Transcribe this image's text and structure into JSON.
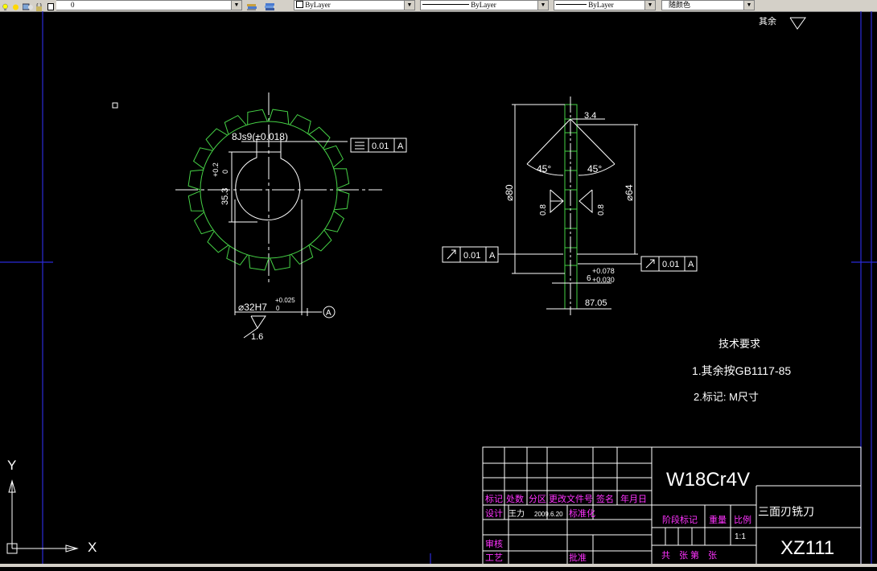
{
  "toolbar": {
    "layer_value": "0",
    "color_value": "ByLayer",
    "linetype_value": "ByLayer",
    "lineweight_value": "ByLayer",
    "plotstyle_value": "随颜色"
  },
  "drawing": {
    "surface_roughness_other": "其余",
    "left_view": {
      "keyway_dim": "8Js9(±0.018)",
      "flatness_value": "0.01",
      "datum_ref_1": "A",
      "key_height_dim": "35.3",
      "key_height_tol": "+0.2",
      "key_height_tol_low": "0",
      "bore_dim": "⌀32H7",
      "bore_tol_up": "+0.025",
      "bore_tol_low": "0",
      "datum_label": "A",
      "roughness_value": "1.6"
    },
    "right_view": {
      "width_dim": "3.4",
      "angle_left": "45°",
      "angle_right": "45°",
      "outer_dia": "⌀80",
      "inner_dia": "⌀64",
      "roughness_left": "0.8",
      "roughness_right": "0.8",
      "runout_left_value": "0.01",
      "runout_left_datum": "A",
      "runout_right_value": "0.01",
      "runout_right_datum": "A",
      "thickness_dim": "6",
      "thickness_tol_up": "+0.078",
      "thickness_tol_low": "+0.030",
      "total_width_dim": "87.05"
    },
    "tech_requirements": {
      "title": "技术要求",
      "item1": "1.其余按GB1117-85",
      "item2": "2.标记: M尺寸"
    },
    "title_block": {
      "material": "W18Cr4V",
      "part_name": "三面刃铣刀",
      "drawing_no": "XZ111",
      "mark_label": "标记",
      "count_label": "处数",
      "zone_label": "分区",
      "change_doc_label": "更改文件号",
      "sign_label": "签名",
      "date_label": "年月日",
      "design_label": "设计",
      "designer": "王力",
      "design_date": "2009.6.20",
      "standardize_label": "标准化",
      "review_label": "审核",
      "process_label": "工艺",
      "approve_label": "批准",
      "stage_label": "阶段标记",
      "weight_label": "重量",
      "scale_label": "比例",
      "scale_value": "1:1",
      "sheets_label": "共　张 第　张"
    },
    "ucs": {
      "y_label": "Y",
      "x_label": "X"
    }
  },
  "colors": {
    "line_white": "#ffffff",
    "line_green": "#46d246",
    "text_magenta": "#ff33ff",
    "border_blue": "#2b2bd8",
    "text_yellow": "#ffff33"
  }
}
